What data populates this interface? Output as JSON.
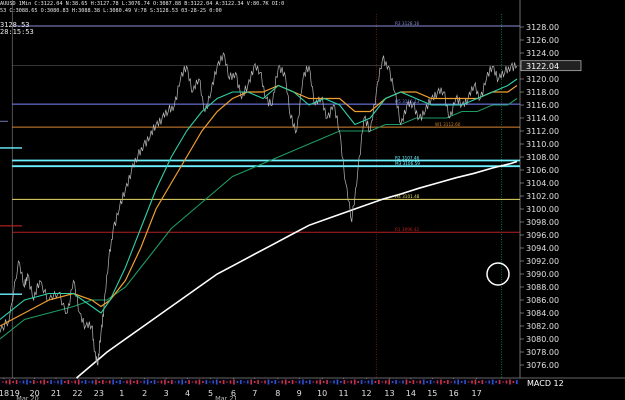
{
  "header": {
    "line1": "AUUSD 1Min C:3122.04 N:38.65 H:3127.78 L:3076.74 O:3087.88 B:3122.04 A:3122.34 V:80.7K OI:0",
    "line2": "53 C:3088.65 O:3080.83 H:3088.38 L:3080.49 V:78 S:3128.53 03-28-25 0:00",
    "line3": "3128.53",
    "line4": "28:15:53"
  },
  "price_badge": "3122.04",
  "macd_label": "MACD 12",
  "level_labels": {
    "r3": "R3 3128.16",
    "r2": "R2 3107.46",
    "m3": "M3 3106.59",
    "h5": "H5 3116.13",
    "h4": "H4 3101.48",
    "r1": "R1 3096.42",
    "w1": "W1 3112.60"
  },
  "colors": {
    "background": "#000000",
    "price": "#b9b9b9",
    "ema_fast": "#2fd1a8",
    "ema_mid": "#f0a030",
    "ma_slow": "#1e9a63",
    "ma_long": "#ffffff",
    "level_blue": "#7a88ff",
    "level_cyan": "#6cf0ff",
    "level_orange": "#d8872f",
    "level_yellow": "#e8dc6a",
    "level_red": "#b42020",
    "level_r3": "#8a8fd8",
    "vline_red": "#a02020",
    "vline_green": "#12a860"
  },
  "chart_data": {
    "type": "line",
    "title": "",
    "ylim": [
      3074,
      3130
    ],
    "y_ticks": [
      3076,
      3078,
      3080,
      3082,
      3084,
      3086,
      3088,
      3090,
      3092,
      3094,
      3096,
      3098,
      3100,
      3102,
      3104,
      3106,
      3108,
      3110,
      3112,
      3114,
      3116,
      3118,
      3120,
      3122,
      3124,
      3126,
      3128
    ],
    "x_ticks": [
      "18",
      "19",
      "20",
      "21",
      "22",
      "23",
      "1",
      "2",
      "3",
      "4",
      "5",
      "6",
      "7",
      "8",
      "9",
      "10",
      "11",
      "12",
      "13",
      "14",
      "15",
      "16",
      "17"
    ],
    "x_sub_labels": [
      "Mar 20",
      "Mar 21"
    ],
    "x_range": [
      17.7,
      17.9
    ],
    "price": {
      "x": [
        17.7,
        18.0,
        18.3,
        18.5,
        18.6,
        18.8,
        19.0,
        19.3,
        19.6,
        19.9,
        20.1,
        20.3,
        20.5,
        20.7,
        20.8,
        20.9,
        21.0,
        21.1,
        21.25,
        21.4,
        21.6,
        21.8,
        22.0,
        22.2,
        22.4,
        22.6,
        22.8,
        23.0,
        23.2,
        23.4,
        23.6,
        23.8,
        24.0,
        24.2,
        24.4,
        24.6,
        24.8,
        25.0,
        25.2,
        25.4,
        25.6,
        25.8,
        26.0,
        26.2,
        26.4,
        26.6,
        26.8,
        27.0,
        27.2,
        27.4,
        27.6,
        27.8,
        28.0,
        28.2,
        28.4,
        28.6,
        28.8,
        29.0,
        29.2,
        29.4,
        29.6,
        29.8,
        30.0,
        30.2,
        30.4,
        30.6,
        30.8,
        31.0,
        31.2,
        31.4,
        31.6,
        31.8,
        32.0,
        32.2,
        32.4,
        32.6,
        32.8,
        33.0,
        33.2,
        33.4,
        33.6,
        33.8,
        34.0,
        34.2,
        34.4,
        34.6
      ],
      "y": [
        3081,
        3083,
        3092,
        3088,
        3090,
        3086,
        3089,
        3086,
        3087,
        3084,
        3089,
        3084,
        3082,
        3082,
        3078,
        3076,
        3081,
        3085,
        3092,
        3097,
        3100,
        3103,
        3106,
        3108,
        3110,
        3111,
        3113,
        3114,
        3115,
        3116,
        3120,
        3122,
        3118,
        3120,
        3115,
        3118,
        3122,
        3124,
        3120,
        3121,
        3117,
        3119,
        3122,
        3121,
        3117,
        3116,
        3122,
        3121,
        3114,
        3112,
        3120,
        3122,
        3116,
        3117,
        3114,
        3116,
        3112,
        3104,
        3098,
        3106,
        3114,
        3112,
        3118,
        3123,
        3122,
        3118,
        3113,
        3116,
        3116,
        3114,
        3115,
        3117,
        3118,
        3118,
        3114,
        3117,
        3116,
        3117,
        3119,
        3117,
        3120,
        3122,
        3120,
        3121,
        3122,
        3122
      ]
    },
    "ema_fast": {
      "x": [
        17.7,
        18.5,
        19.3,
        20.1,
        20.7,
        21.0,
        21.3,
        21.8,
        22.3,
        22.8,
        23.3,
        23.8,
        24.3,
        24.8,
        25.3,
        25.8,
        26.3,
        26.8,
        27.3,
        27.8,
        28.3,
        28.8,
        29.3,
        29.8,
        30.3,
        30.8,
        31.3,
        31.8,
        32.3,
        32.8,
        33.3,
        33.8,
        34.3,
        34.6
      ],
      "y": [
        3083,
        3086,
        3087,
        3087,
        3085,
        3084,
        3086,
        3091,
        3097,
        3103,
        3108,
        3112,
        3115,
        3117,
        3118,
        3118,
        3117,
        3119,
        3118,
        3116,
        3117,
        3116,
        3113,
        3114,
        3117,
        3118,
        3117,
        3116,
        3116,
        3116,
        3117,
        3118,
        3119,
        3120
      ]
    },
    "ema_mid": {
      "x": [
        17.7,
        18.5,
        19.3,
        20.1,
        20.7,
        21.0,
        21.3,
        21.8,
        22.3,
        22.8,
        23.3,
        23.8,
        24.3,
        24.8,
        25.3,
        25.8,
        26.3,
        26.8,
        27.3,
        27.8,
        28.3,
        28.8,
        29.3,
        29.8,
        30.3,
        30.8,
        31.3,
        31.8,
        32.3,
        32.8,
        33.3,
        33.8,
        34.3,
        34.6
      ],
      "y": [
        3082,
        3084,
        3086,
        3087,
        3086,
        3085,
        3086,
        3089,
        3094,
        3100,
        3104,
        3108,
        3112,
        3115,
        3117,
        3118,
        3118,
        3119,
        3118,
        3117,
        3117,
        3117,
        3115,
        3115,
        3117,
        3118,
        3118,
        3117,
        3117,
        3117,
        3117,
        3118,
        3118,
        3119
      ]
    },
    "ma_slow": {
      "x": [
        17.7,
        18.5,
        19.3,
        20.1,
        20.7,
        21.2,
        21.8,
        22.3,
        22.8,
        23.3,
        23.8,
        24.3,
        24.8,
        25.3,
        25.8,
        26.3,
        26.8,
        27.3,
        27.8,
        28.3,
        28.8,
        29.3,
        29.8,
        30.3,
        30.8,
        31.3,
        31.8,
        32.3,
        32.8,
        33.3,
        33.8,
        34.3,
        34.6
      ],
      "y": [
        3080,
        3083,
        3084,
        3085,
        3086,
        3086,
        3088,
        3091,
        3094,
        3097,
        3099,
        3101,
        3103,
        3105,
        3106,
        3107,
        3108,
        3109,
        3110,
        3111,
        3112,
        3112,
        3112,
        3113,
        3113,
        3114,
        3114,
        3114,
        3115,
        3115,
        3116,
        3116,
        3117
      ]
    },
    "ma_long": {
      "x": [
        20.2,
        20.7,
        21.2,
        21.8,
        22.4,
        23.0,
        23.6,
        24.2,
        24.8,
        25.4,
        26.0,
        26.6,
        27.2,
        27.8,
        28.4,
        29.0,
        29.6,
        30.2,
        30.8,
        31.4,
        32.0,
        32.6,
        33.2,
        33.8,
        34.4,
        34.6
      ],
      "y": [
        3074,
        3076,
        3078,
        3080,
        3082,
        3084,
        3086,
        3088,
        3090,
        3091.5,
        3093,
        3094.5,
        3096,
        3097.5,
        3098.5,
        3099.5,
        3100.5,
        3101.5,
        3102.3,
        3103.2,
        3104,
        3104.8,
        3105.5,
        3106.3,
        3107,
        3107.3
      ]
    },
    "levels": [
      {
        "label": "R3 3128.16",
        "y": 3128.16,
        "color": "#8a8fd8"
      },
      {
        "label": "H5 3116.13",
        "y": 3116.13,
        "color": "#7a88ff"
      },
      {
        "label": "W1 3112.60",
        "y": 3112.6,
        "color": "#d8872f"
      },
      {
        "label": "R2 3107.46",
        "y": 3107.46,
        "color": "#6cf0ff"
      },
      {
        "label": "M3 3106.59",
        "y": 3106.59,
        "color": "#6cf0ff"
      },
      {
        "label": "H4 3101.48",
        "y": 3101.48,
        "color": "#e8dc6a"
      },
      {
        "label": "R1 3096.42",
        "y": 3096.42,
        "color": "#b42020"
      }
    ]
  }
}
